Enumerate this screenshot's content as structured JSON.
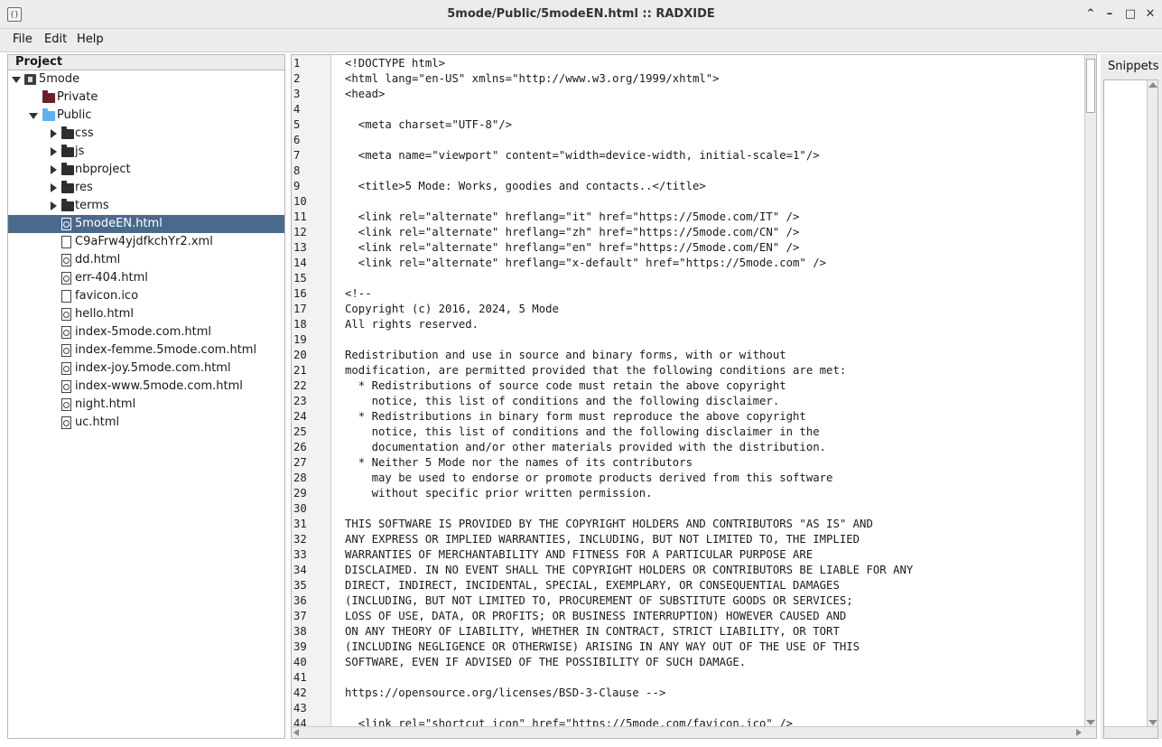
{
  "window": {
    "title": "5mode/Public/5modeEN.html :: RADXIDE",
    "app_icon": "{}",
    "controls": {
      "collapse": "⌃",
      "minimize": "–",
      "maximize": "□",
      "close": "✕"
    }
  },
  "menu": {
    "file": "File",
    "edit": "Edit",
    "help": "Help"
  },
  "project": {
    "header": "Project",
    "root": "5mode",
    "private": "Private",
    "public": "Public",
    "folders": [
      "css",
      "js",
      "nbproject",
      "res",
      "terms"
    ],
    "files": [
      "5modeEN.html",
      "C9aFrw4yjdfkchYr2.xml",
      "dd.html",
      "err-404.html",
      "favicon.ico",
      "hello.html",
      "index-5mode.com.html",
      "index-femme.5mode.com.html",
      "index-joy.5mode.com.html",
      "index-www.5mode.com.html",
      "night.html",
      "uc.html"
    ],
    "selected_file": "5modeEN.html"
  },
  "editor": {
    "line_numbers": [
      "1",
      "2",
      "3",
      "4",
      "5",
      "6",
      "7",
      "8",
      "9",
      "10",
      "11",
      "12",
      "13",
      "14",
      "15",
      "16",
      "17",
      "18",
      "19",
      "20",
      "21",
      "22",
      "23",
      "24",
      "25",
      "26",
      "27",
      "28",
      "29",
      "30",
      "31",
      "32",
      "33",
      "34",
      "35",
      "36",
      "37",
      "38",
      "39",
      "40",
      "41",
      "42",
      "43",
      "44"
    ],
    "lines": [
      "<!DOCTYPE html>",
      "<html lang=\"en-US\" xmlns=\"http://www.w3.org/1999/xhtml\">",
      "<head>",
      "",
      "  <meta charset=\"UTF-8\"/>",
      "",
      "  <meta name=\"viewport\" content=\"width=device-width, initial-scale=1\"/>",
      "",
      "  <title>5 Mode: Works, goodies and contacts..</title>",
      "",
      "  <link rel=\"alternate\" hreflang=\"it\" href=\"https://5mode.com/IT\" />",
      "  <link rel=\"alternate\" hreflang=\"zh\" href=\"https://5mode.com/CN\" />",
      "  <link rel=\"alternate\" hreflang=\"en\" href=\"https://5mode.com/EN\" />",
      "  <link rel=\"alternate\" hreflang=\"x-default\" href=\"https://5mode.com\" />",
      "",
      "<!--",
      "Copyright (c) 2016, 2024, 5 Mode",
      "All rights reserved.",
      "",
      "Redistribution and use in source and binary forms, with or without",
      "modification, are permitted provided that the following conditions are met:",
      "  * Redistributions of source code must retain the above copyright",
      "    notice, this list of conditions and the following disclaimer.",
      "  * Redistributions in binary form must reproduce the above copyright",
      "    notice, this list of conditions and the following disclaimer in the",
      "    documentation and/or other materials provided with the distribution.",
      "  * Neither 5 Mode nor the names of its contributors",
      "    may be used to endorse or promote products derived from this software",
      "    without specific prior written permission.",
      "",
      "THIS SOFTWARE IS PROVIDED BY THE COPYRIGHT HOLDERS AND CONTRIBUTORS \"AS IS\" AND",
      "ANY EXPRESS OR IMPLIED WARRANTIES, INCLUDING, BUT NOT LIMITED TO, THE IMPLIED",
      "WARRANTIES OF MERCHANTABILITY AND FITNESS FOR A PARTICULAR PURPOSE ARE",
      "DISCLAIMED. IN NO EVENT SHALL THE COPYRIGHT HOLDERS OR CONTRIBUTORS BE LIABLE FOR ANY",
      "DIRECT, INDIRECT, INCIDENTAL, SPECIAL, EXEMPLARY, OR CONSEQUENTIAL DAMAGES",
      "(INCLUDING, BUT NOT LIMITED TO, PROCUREMENT OF SUBSTITUTE GOODS OR SERVICES;",
      "LOSS OF USE, DATA, OR PROFITS; OR BUSINESS INTERRUPTION) HOWEVER CAUSED AND",
      "ON ANY THEORY OF LIABILITY, WHETHER IN CONTRACT, STRICT LIABILITY, OR TORT",
      "(INCLUDING NEGLIGENCE OR OTHERWISE) ARISING IN ANY WAY OUT OF THE USE OF THIS",
      "SOFTWARE, EVEN IF ADVISED OF THE POSSIBILITY OF SUCH DAMAGE.",
      "",
      "https://opensource.org/licenses/BSD-3-Clause -->",
      "",
      "  <link rel=\"shortcut icon\" href=\"https://5mode.com/favicon.ico\" />"
    ]
  },
  "snippets": {
    "title": "Snippets"
  },
  "colors": {
    "selection": "#4a6a8c",
    "folder_private": "#6b1f2a",
    "folder_public": "#5fb1f0"
  }
}
